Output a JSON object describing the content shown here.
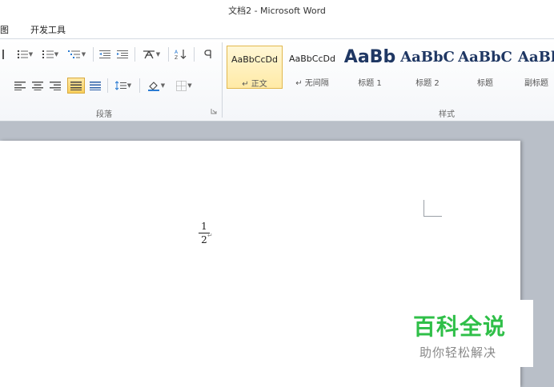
{
  "window": {
    "title": "文档2 - Microsoft Word"
  },
  "tabs": [
    {
      "label": "图"
    },
    {
      "label": "开发工具"
    }
  ],
  "groups": {
    "paragraph": {
      "label": "段落"
    },
    "styles": {
      "label": "样式"
    }
  },
  "styles": [
    {
      "sample": "AaBbCcDd",
      "name": "↵ 正文",
      "selected": true
    },
    {
      "sample": "AaBbCcDd",
      "name": "↵ 无间隔"
    },
    {
      "sample": "AaBb",
      "name": "标题 1"
    },
    {
      "sample": "AaBbC",
      "name": "标题 2"
    },
    {
      "sample": "AaBbC",
      "name": "标题"
    },
    {
      "sample": "AaBl",
      "name": "副标题"
    }
  ],
  "document": {
    "numerator": "1",
    "denominator": "2",
    "paragraph_mark": "↵"
  },
  "watermark": {
    "title": "百科全说",
    "subtitle": "助你轻松解决"
  },
  "colors": {
    "accent_green": "#2fbf48",
    "selected_style": "#ffeaa6",
    "heading_text": "#1f3763"
  }
}
